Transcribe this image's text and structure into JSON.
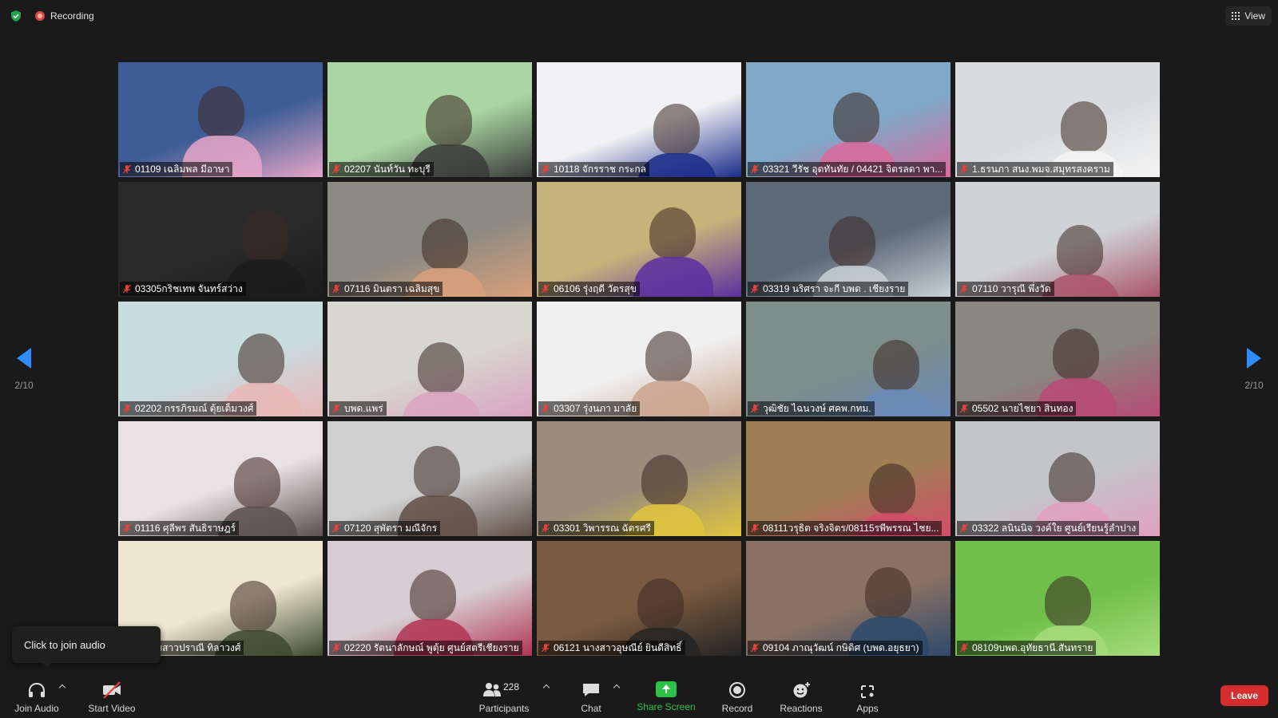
{
  "top_bar": {
    "recording_label": "Recording",
    "view_label": "View",
    "icons": [
      "shield-check-icon",
      "recording-icon",
      "grid-view-icon"
    ]
  },
  "pagination": {
    "left_label": "2/10",
    "right_label": "2/10"
  },
  "participants": [
    {
      "name": "01109 เฉลิมพล มีอาษา",
      "muted": true
    },
    {
      "name": "02207 นันท์วัน ทะบุรี",
      "muted": true
    },
    {
      "name": "10118 จักรราช กระกล",
      "muted": true
    },
    {
      "name": "03321 วีรัช อุดทันทัย / 04421 จิตรลดา พา...",
      "muted": true
    },
    {
      "name": "1.ธรนภา สนง.พมจ.สมุทรสงคราม",
      "muted": true
    },
    {
      "name": "03305กริชเทพ จันทร์สว่าง",
      "muted": true
    },
    {
      "name": "07116 มินตรา เฉลิมสุข",
      "muted": true
    },
    {
      "name": "06106 รุ่งฤดี วัตรสุข",
      "muted": true
    },
    {
      "name": "03319 นริศรา จะกี บพด . เชียงราย",
      "muted": true
    },
    {
      "name": "07110 วารุณี พึ่งวัด",
      "muted": true
    },
    {
      "name": "02202 กรรภิรมณ์ ตุ้ยเต็มวงศ์",
      "muted": true
    },
    {
      "name": "บพด.แพร่",
      "muted": true
    },
    {
      "name": "03307 รุ่งนภา มาลัย",
      "muted": true
    },
    {
      "name": "วุฒิชัย ไฉนวงษ์ ศคพ.กทม.",
      "muted": true
    },
    {
      "name": "05502 นายไชยา สินทอง",
      "muted": true
    },
    {
      "name": "01116 ศุลีพร สันธิราษฎร์",
      "muted": true
    },
    {
      "name": "07120 สุพัตรา มณีจักร",
      "muted": true
    },
    {
      "name": "03301 วิพารรณ ฉัตรศรี",
      "muted": true
    },
    {
      "name": "08111วรุธิต จริงจิตร/08115รพีพรรณ ไชย...",
      "muted": true
    },
    {
      "name": "03322 ลนินนิจ วงค์ใย ศูนย์เรียนรู้ลำปาง",
      "muted": true
    },
    {
      "name": "05นางสาวปราณี ทิลาวงศ์",
      "muted": true
    },
    {
      "name": "02220 รัตนาลักษณ์ พูตุ้ย ศูนย์สตรีเชียงราย",
      "muted": true
    },
    {
      "name": "06121 นางสาวอุษณีย์ ยินดีสิทธิ์",
      "muted": true
    },
    {
      "name": "09104 ภาณุวัฒน์ กษิดิศ (บพด.อยุธยา)",
      "muted": true
    },
    {
      "name": "08109บพด.อุทัยธานี.สันทราย",
      "muted": true
    }
  ],
  "tooltip": {
    "text": "Click to join audio"
  },
  "toolbar": {
    "join_audio_label": "Join Audio",
    "start_video_label": "Start Video",
    "participants_label": "Participants",
    "participants_count": "228",
    "chat_label": "Chat",
    "share_screen_label": "Share Screen",
    "record_label": "Record",
    "reactions_label": "Reactions",
    "apps_label": "Apps",
    "leave_label": "Leave"
  },
  "colors": {
    "accent_blue": "#2d8cff",
    "share_green": "#2ec24b",
    "leave_red": "#d42e2e",
    "recording_red": "#d94b4b",
    "mic_off_red": "#e8403c"
  }
}
